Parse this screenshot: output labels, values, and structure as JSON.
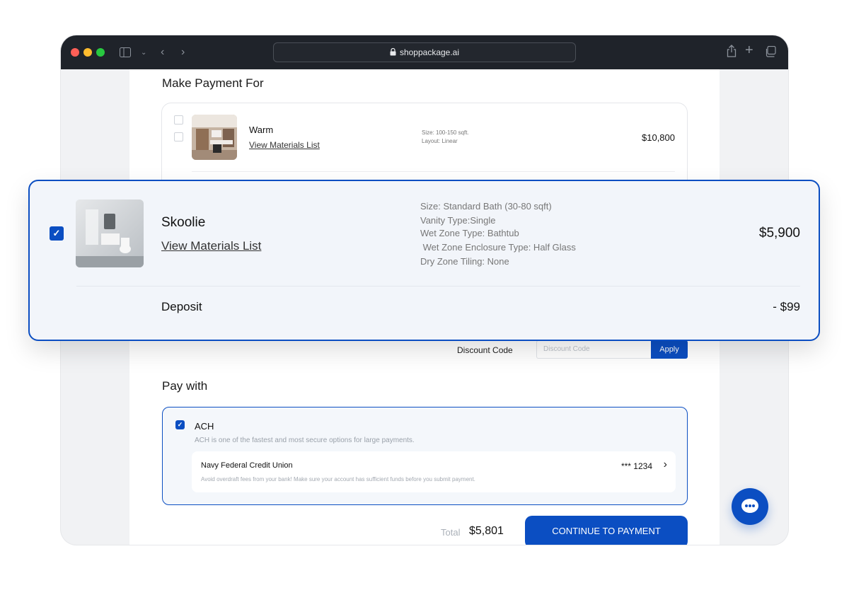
{
  "browser": {
    "url": "shoppackage.ai"
  },
  "page": {
    "heading": "Make Payment For",
    "items": [
      {
        "name": "Warm",
        "link": "View Materials List",
        "specs": [
          "Size: 100-150 sqft.",
          "Layout: Linear"
        ],
        "price": "$10,800",
        "selected": false
      }
    ],
    "discount": {
      "label": "Discount Code",
      "placeholder": "Discount Code",
      "apply_label": "Apply"
    },
    "pay_with": {
      "heading": "Pay with",
      "method": "ACH",
      "method_desc": "ACH is one of the fastest and most secure options for large payments.",
      "bank_name": "Navy Federal Credit Union",
      "bank_mask": "*** 1234",
      "bank_note": "Avoid overdraft fees from your bank! Make sure your account has sufficient funds before you submit payment.",
      "selected": true
    },
    "total_label": "Total",
    "total_value": "$5,801",
    "continue_label": "CONTINUE TO PAYMENT"
  },
  "overlay": {
    "name": "Skoolie",
    "link": "View Materials List",
    "specs": [
      "Size: Standard Bath (30-80 sqft)",
      "Vanity Type:Single",
      "Wet Zone Type: Bathtub",
      " Wet Zone Enclosure Type: Half Glass",
      "Dry Zone Tiling: None"
    ],
    "price": "$5,900",
    "deposit_label": "Deposit",
    "deposit_amount": "- $99",
    "selected": true
  },
  "colors": {
    "accent": "#0b4ec2",
    "titlebar": "#1f232a",
    "overlay_bg": "#f2f5fa"
  },
  "icons": [
    "lock-icon",
    "sidebar-icon",
    "chevron-left-icon",
    "chevron-right-icon",
    "share-icon",
    "plus-icon",
    "tabs-icon",
    "chat-icon",
    "checkbox-checked-icon"
  ]
}
